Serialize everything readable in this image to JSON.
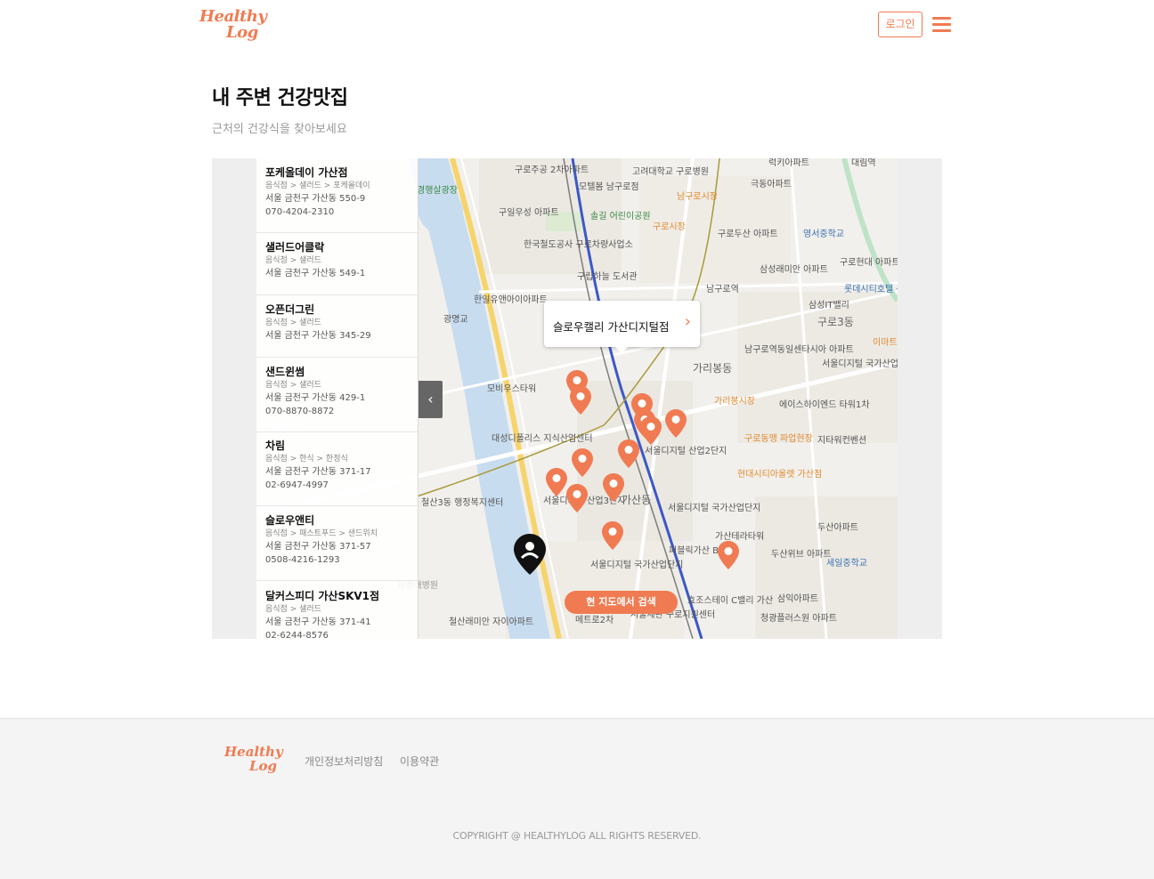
{
  "header": {
    "logo_line1": "Healthy",
    "logo_line2": "Log",
    "login_label": "로그인",
    "menu_icon": "hamburger-menu-icon"
  },
  "page": {
    "title": "내 주변 건강맛집",
    "subtitle": "근처의 건강식을 찾아보세요"
  },
  "restaurants": [
    {
      "name": "포케올데이 가산점",
      "category": "음식점 > 샐러드 > 포케올데이",
      "address": "서울 금천구 가산동 550-9",
      "phone": "070-4204-2310"
    },
    {
      "name": "샐러드어클락",
      "category": "음식점 > 샐러드",
      "address": "서울 금천구 가산동 549-1",
      "phone": ""
    },
    {
      "name": "오픈더그린",
      "category": "음식점 > 샐러드",
      "address": "서울 금천구 가산동 345-29",
      "phone": ""
    },
    {
      "name": "샌드윈썸",
      "category": "음식점 > 샐러드",
      "address": "서울 금천구 가산동 429-1",
      "phone": "070-8870-8872"
    },
    {
      "name": "차림",
      "category": "음식점 > 한식 > 한정식",
      "address": "서울 금천구 가산동 371-17",
      "phone": "02-6947-4997"
    },
    {
      "name": "슬로우앤티",
      "category": "음식점 > 패스트푸드 > 샌드위치",
      "address": "서울 금천구 가산동 371-57",
      "phone": "0508-4216-1293"
    },
    {
      "name": "달커스피디 가산SKV1점",
      "category": "음식점 > 샐러드",
      "address": "서울 금천구 가산동 371-41",
      "phone": "02-6244-8576"
    }
  ],
  "map": {
    "popup_title": "슬로우캘리 가산디지털점",
    "search_label": "현 지도에서 검색",
    "accent_color": "#f07b52",
    "labels": [
      "구로주공 2차아파트",
      "모텔봄 남구로점",
      "고려대학교 구로병원",
      "럭키아파트",
      "대림역",
      "경행살광장",
      "극동아파트",
      "구일우성 아파트",
      "솔길 어린이공원",
      "남구로시장",
      "구로시장",
      "영서중학교",
      "한국철도공사 구로차량사업소",
      "구로두산 아파트",
      "구로현대 아파트",
      "구립하늘 도서관",
      "삼성래미안 아파트",
      "남구로역",
      "롯데시티호텔 구로",
      "삼성IT밸리",
      "구로3동",
      "한일유앤아이아파트",
      "광명교",
      "남구로역동일센타시아 아파트",
      "이마트",
      "가리봉동",
      "서울디지털 국가산업단지",
      "모비우스타워",
      "가리봉시장",
      "에이스하이엔드 타워1차",
      "대성디폴리스 지식산업센터",
      "지타워컨벤션",
      "구로동맹 파업현장",
      "현대시티아울렛 가산점",
      "서울디지털 산업2단지",
      "가산동",
      "철산3동 행정복지센터",
      "서울디지털 산업3단지",
      "서울디지털 국가산업단지",
      "가산테라타워",
      "두산위브 아파트",
      "두산아파트",
      "퍼블릭가산 B동",
      "세일중학교",
      "서울디지털 국가산업단지",
      "삼익아파트",
      "메트로2차",
      "효조스테이 C밸리 가산",
      "서울세관 구로지원센터",
      "청광플러스원 아파트",
      "철산래미안 자이아파트",
      "광명애병원"
    ]
  },
  "footer": {
    "logo_line1": "Healthy",
    "logo_line2": "Log",
    "privacy_label": "개인정보처리방침",
    "terms_label": "이용약관",
    "copyright": "COPYRIGHT @ HEALTHYLOG ALL RIGHTS RESERVED."
  }
}
